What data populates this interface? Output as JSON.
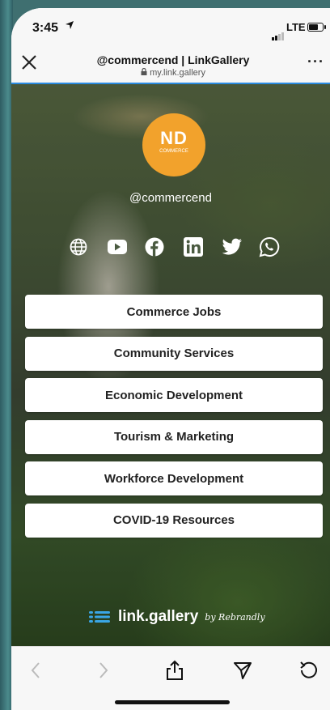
{
  "status_bar": {
    "time": "3:45",
    "network": "LTE"
  },
  "browser": {
    "close_icon": "close-icon",
    "title": "@commercend | LinkGallery",
    "url": "my.link.gallery",
    "more_label": "···"
  },
  "profile": {
    "logo_text": "ND",
    "logo_subtext": "COMMERCE",
    "handle": "@commercend",
    "logo_color": "#f2a22c"
  },
  "socials": [
    {
      "name": "globe-icon"
    },
    {
      "name": "youtube-icon"
    },
    {
      "name": "facebook-icon"
    },
    {
      "name": "linkedin-icon"
    },
    {
      "name": "twitter-icon"
    },
    {
      "name": "whatsapp-icon"
    }
  ],
  "links": [
    {
      "label": "Commerce Jobs"
    },
    {
      "label": "Community Services"
    },
    {
      "label": "Economic Development"
    },
    {
      "label": "Tourism & Marketing"
    },
    {
      "label": "Workforce Development"
    },
    {
      "label": "COVID-19 Resources"
    }
  ],
  "brand": {
    "name": "link.gallery",
    "by": "by Rebrandly",
    "accent": "#3aa6e6"
  },
  "toolbar": {
    "back": "chevron-left-icon",
    "forward": "chevron-right-icon",
    "share": "share-icon",
    "send": "send-icon",
    "reload": "reload-icon"
  }
}
